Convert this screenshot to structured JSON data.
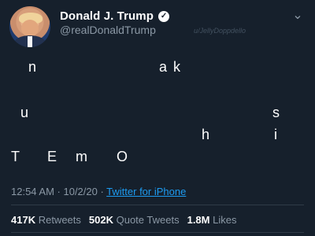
{
  "tweet": {
    "author": {
      "name": "Donald J. Trump",
      "handle": "@realDonaldTrump",
      "verified_icon": "verified-badge-icon",
      "avatar_icon": "avatar-image"
    },
    "watermark": "u/JellyDoppdello",
    "menu_icon": "chevron-down-icon",
    "text_chars": [
      "n",
      "a",
      "k",
      "u",
      "s",
      "h",
      "i",
      "T",
      "E",
      "m",
      "O"
    ],
    "timestamp": "12:54 AM · 10/2/20 · ",
    "source": "Twitter for iPhone",
    "stats": {
      "retweets_count": "417K",
      "retweets_label": "Retweets",
      "quote_count": "502K",
      "quote_label": "Quote Tweets",
      "likes_count": "1.8M",
      "likes_label": "Likes"
    },
    "colors": {
      "background": "#16202c",
      "link": "#1d9bf0",
      "secondary_text": "#8b98a5"
    }
  }
}
